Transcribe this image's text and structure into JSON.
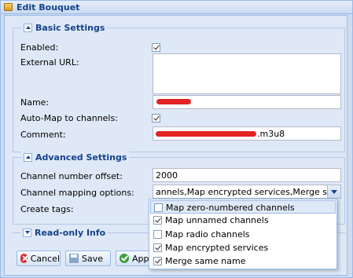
{
  "window": {
    "title": "Edit Bouquet"
  },
  "basic": {
    "legend": "Basic Settings",
    "enabled_label": "Enabled:",
    "enabled_checked": true,
    "external_url_label": "External URL:",
    "external_url_value": "",
    "name_label": "Name:",
    "automap_label": "Auto-Map to channels:",
    "automap_checked": true,
    "comment_label": "Comment:",
    "comment_visible_suffix": ".m3u8"
  },
  "advanced": {
    "legend": "Advanced Settings",
    "offset_label": "Channel number offset:",
    "offset_value": "2000",
    "mapping_label": "Channel mapping options:",
    "mapping_value": "annels,Map encrypted services,Merge same name",
    "tags_label": "Create tags:"
  },
  "readonly": {
    "legend": "Read-only Info"
  },
  "dropdown": {
    "options": [
      {
        "label": "Map zero-numbered channels",
        "checked": false
      },
      {
        "label": "Map unnamed channels",
        "checked": true
      },
      {
        "label": "Map radio channels",
        "checked": false
      },
      {
        "label": "Map encrypted services",
        "checked": true
      },
      {
        "label": "Merge same name",
        "checked": true
      }
    ]
  },
  "buttons": {
    "cancel": "Cancel",
    "save": "Save",
    "apply": "App"
  },
  "colors": {
    "accent": "#15428b",
    "panel": "#dfe8f6",
    "border": "#99bbe8",
    "redaction": "#e32222"
  }
}
